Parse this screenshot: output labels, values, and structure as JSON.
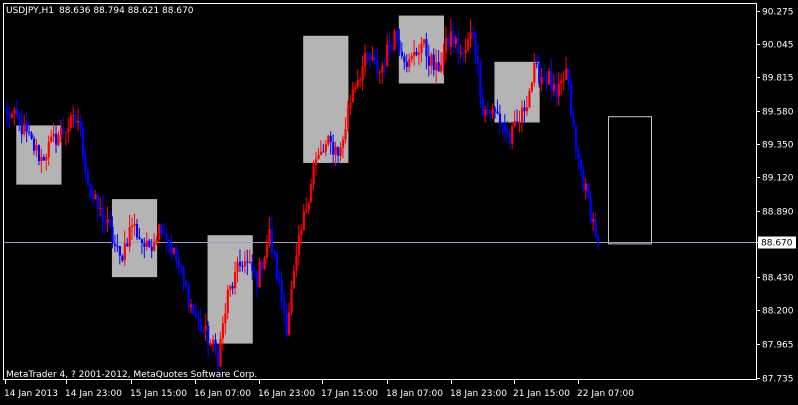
{
  "header": {
    "symbol": "USDJPY,H1",
    "ohlc": "88.636 88.794 88.621 88.670"
  },
  "footer": {
    "copyright": "MetaTrader 4, ? 2001-2012, MetaQuotes Software Corp."
  },
  "colors": {
    "background": "#000000",
    "frame": "#ffffff",
    "bull": "#ff0000",
    "bear": "#0000ff",
    "session_box": "#b4b4b4",
    "current_price_line": "#9aa0c0",
    "price_label_bg": "#ffffff",
    "price_label_text": "#000000"
  },
  "chart_data": {
    "type": "candlestick",
    "symbol": "USDJPY",
    "timeframe": "H1",
    "ylim": [
      87.725,
      90.32
    ],
    "y_ticks": [
      "90.275",
      "90.045",
      "89.815",
      "89.580",
      "89.350",
      "89.120",
      "88.890",
      "88.670",
      "88.430",
      "88.200",
      "87.965",
      "87.735"
    ],
    "x_ticks": [
      "14 Jan 2013",
      "14 Jan 23:00",
      "15 Jan 15:00",
      "16 Jan 07:00",
      "16 Jan 23:00",
      "17 Jan 15:00",
      "18 Jan 07:00",
      "18 Jan 23:00",
      "21 Jan 15:00",
      "22 Jan 07:00"
    ],
    "current_price": 88.67,
    "current_price_label": "88.670",
    "session_boxes": [
      {
        "low": 89.07,
        "high": 89.48
      },
      {
        "low": 88.43,
        "high": 88.97
      },
      {
        "low": 87.97,
        "high": 88.72
      },
      {
        "low": 89.22,
        "high": 90.1
      },
      {
        "low": 89.77,
        "high": 90.24
      },
      {
        "low": 89.5,
        "high": 89.92
      }
    ],
    "projection_box": {
      "low": 88.66,
      "high": 89.54
    },
    "path": [
      {
        "n": 4,
        "price": 89.55
      },
      {
        "n": 6,
        "price": 89.38
      },
      {
        "n": 5,
        "price": 89.25
      },
      {
        "n": 6,
        "price": 89.4
      },
      {
        "n": 5,
        "price": 89.48
      },
      {
        "n": 4,
        "price": 89.52
      },
      {
        "n": 5,
        "price": 89.0
      },
      {
        "n": 7,
        "price": 88.78
      },
      {
        "n": 5,
        "price": 88.55
      },
      {
        "n": 5,
        "price": 88.8
      },
      {
        "n": 6,
        "price": 88.62
      },
      {
        "n": 6,
        "price": 88.8
      },
      {
        "n": 6,
        "price": 88.55
      },
      {
        "n": 7,
        "price": 88.18
      },
      {
        "n": 6,
        "price": 88.0
      },
      {
        "n": 4,
        "price": 87.88
      },
      {
        "n": 4,
        "price": 88.3
      },
      {
        "n": 6,
        "price": 88.55
      },
      {
        "n": 6,
        "price": 88.42
      },
      {
        "n": 5,
        "price": 88.72
      },
      {
        "n": 7,
        "price": 88.1
      },
      {
        "n": 5,
        "price": 88.65
      },
      {
        "n": 6,
        "price": 89.2
      },
      {
        "n": 6,
        "price": 89.35
      },
      {
        "n": 5,
        "price": 89.3
      },
      {
        "n": 5,
        "price": 89.75
      },
      {
        "n": 6,
        "price": 89.95
      },
      {
        "n": 5,
        "price": 89.85
      },
      {
        "n": 6,
        "price": 90.12
      },
      {
        "n": 6,
        "price": 89.9
      },
      {
        "n": 5,
        "price": 90.05
      },
      {
        "n": 6,
        "price": 89.85
      },
      {
        "n": 6,
        "price": 90.1
      },
      {
        "n": 5,
        "price": 89.95
      },
      {
        "n": 4,
        "price": 90.15
      },
      {
        "n": 4,
        "price": 89.6
      },
      {
        "n": 6,
        "price": 89.55
      },
      {
        "n": 5,
        "price": 89.38
      },
      {
        "n": 5,
        "price": 89.55
      },
      {
        "n": 5,
        "price": 89.85
      },
      {
        "n": 6,
        "price": 89.8
      },
      {
        "n": 3,
        "price": 89.65
      },
      {
        "n": 4,
        "price": 89.85
      },
      {
        "n": 4,
        "price": 89.3
      },
      {
        "n": 5,
        "price": 88.95
      },
      {
        "n": 4,
        "price": 88.67
      }
    ]
  }
}
